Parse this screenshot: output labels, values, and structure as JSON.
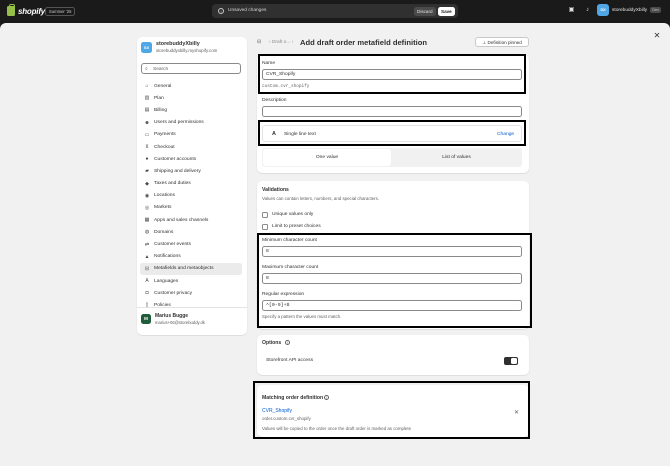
{
  "topbar": {
    "logo_text": "shopify",
    "edition": "Summer '25",
    "unsaved_text": "Unsaved changes",
    "discard_label": "Discard",
    "save_label": "Save",
    "store_initials": "SX",
    "store_name": "storebuddyXbilly",
    "store_tag": "Dev"
  },
  "sidebar": {
    "store_initials": "SX",
    "store_name": "storebuddyXbilly",
    "store_url": "storebuddyxbilly.myshopify.com",
    "search_placeholder": "Search",
    "items": [
      {
        "label": "General",
        "icon": "store-icon"
      },
      {
        "label": "Plan",
        "icon": "chart-icon"
      },
      {
        "label": "Billing",
        "icon": "receipt-icon"
      },
      {
        "label": "Users and permissions",
        "icon": "users-icon"
      },
      {
        "label": "Payments",
        "icon": "payments-icon"
      },
      {
        "label": "Checkout",
        "icon": "cart-icon"
      },
      {
        "label": "Customer accounts",
        "icon": "person-icon"
      },
      {
        "label": "Shipping and delivery",
        "icon": "truck-icon"
      },
      {
        "label": "Taxes and duties",
        "icon": "tax-icon"
      },
      {
        "label": "Locations",
        "icon": "location-icon"
      },
      {
        "label": "Markets",
        "icon": "globe-icon"
      },
      {
        "label": "Apps and sales channels",
        "icon": "apps-icon"
      },
      {
        "label": "Domains",
        "icon": "domain-icon"
      },
      {
        "label": "Customer events",
        "icon": "events-icon"
      },
      {
        "label": "Notifications",
        "icon": "bell-icon"
      },
      {
        "label": "Metafields and metaobjects",
        "icon": "metafields-icon"
      },
      {
        "label": "Languages",
        "icon": "translate-icon"
      },
      {
        "label": "Customer privacy",
        "icon": "lock-icon"
      },
      {
        "label": "Policies",
        "icon": "document-icon"
      }
    ],
    "active_index": 15,
    "user_initial": "M",
    "user_name": "Marius Bugge",
    "user_email": "marius+06@storebuddy.dk"
  },
  "header": {
    "breadcrumb": "Draft o...",
    "title": "Add draft order metafield definition",
    "pinned_label": "Definition pinned"
  },
  "definition": {
    "name_label": "Name",
    "name_value": "CVR_Shopify",
    "namespace_key": "custom.cvr_shopify",
    "description_label": "Description",
    "description_value": "",
    "type_label": "Single line text",
    "type_icon_glyph": "A",
    "change_label": "Change",
    "one_value_label": "One value",
    "list_label": "List of values"
  },
  "validations": {
    "title": "Validations",
    "subtitle": "Values can contain letters, numbers, and special characters.",
    "unique_label": "Unique values only",
    "preset_label": "Limit to preset choices",
    "min_label": "Minimum character count",
    "min_value": "8",
    "max_label": "Maximum character count",
    "max_value": "8",
    "regex_label": "Regular expression",
    "regex_value": "^[0-9]+$",
    "regex_help": "Specify a pattern the values must match."
  },
  "options": {
    "title": "Options",
    "storefront_label": "Storefront API access",
    "storefront_enabled": true
  },
  "matching": {
    "title": "Matching order definition",
    "link_label": "CVR_Shopify",
    "key": "order.custom.cvr_shopify",
    "note": "Values will be copied to the order once the draft order is marked as complete"
  }
}
